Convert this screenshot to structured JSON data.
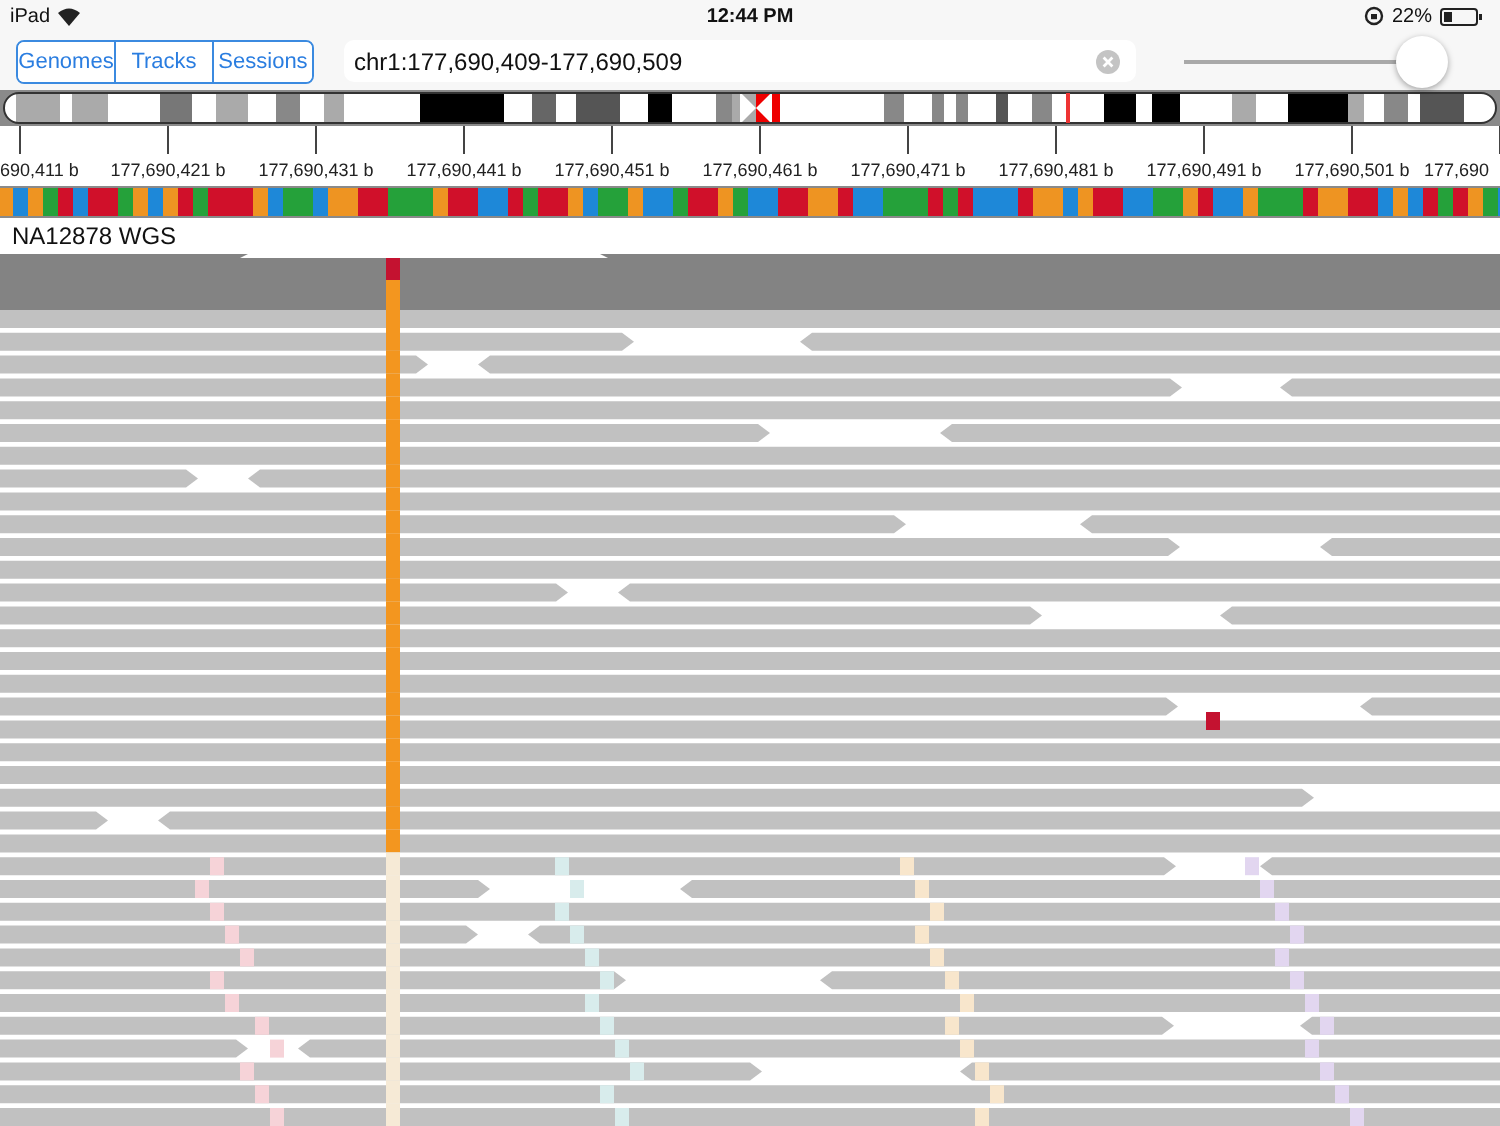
{
  "status_bar": {
    "device": "iPad",
    "time": "12:44 PM",
    "battery": "22%"
  },
  "toolbar": {
    "tabs": [
      {
        "label": "Genomes",
        "selected": false
      },
      {
        "label": "Tracks",
        "selected": false
      },
      {
        "label": "Sessions",
        "selected": false
      }
    ],
    "locus": "chr1:177,690,409-177,690,509",
    "zoom": {
      "level": 0.96
    }
  },
  "ruler": {
    "labels": [
      "690,411 b",
      "177,690,421 b",
      "177,690,431 b",
      "177,690,441 b",
      "177,690,451 b",
      "177,690,461 b",
      "177,690,471 b",
      "177,690,481 b",
      "177,690,491 b",
      "177,690,501 b",
      "177,690"
    ]
  },
  "track": {
    "name": "NA12878 WGS"
  }
}
